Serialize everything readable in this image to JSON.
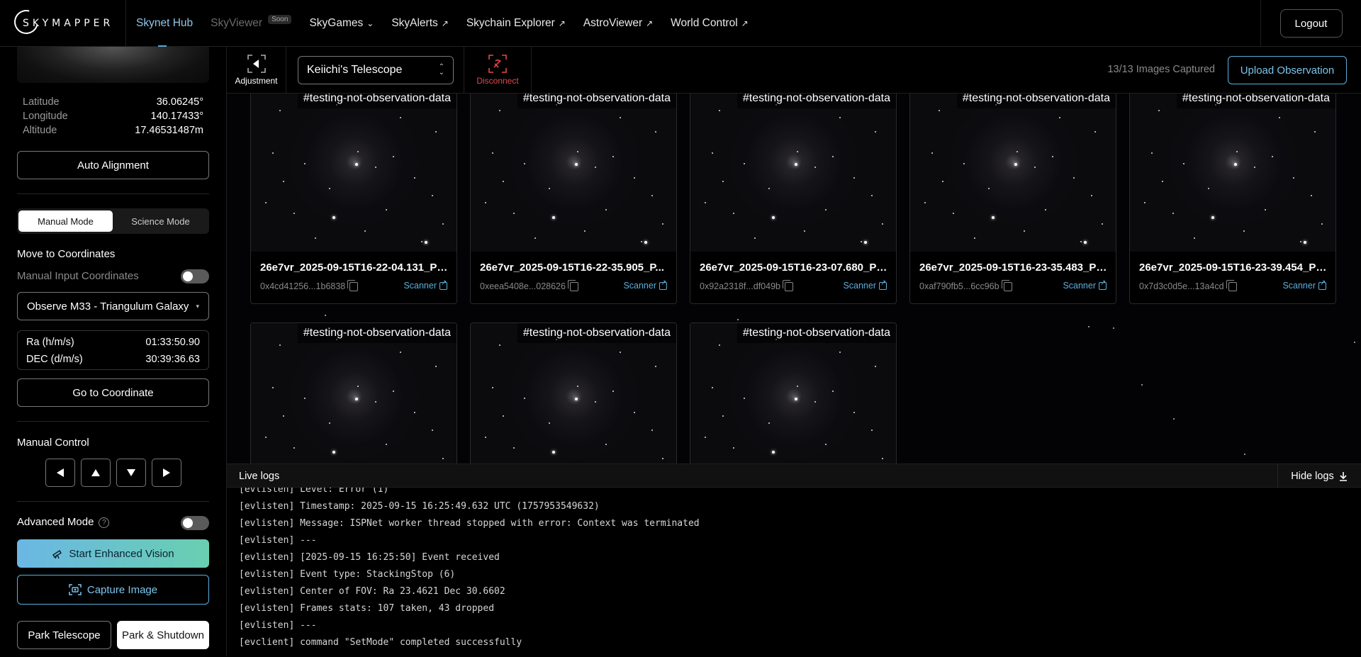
{
  "nav": {
    "brand": "SKYMAPPER",
    "items": [
      {
        "label": "Skynet Hub",
        "state": "active"
      },
      {
        "label": "SkyViewer",
        "badge": "Soon",
        "state": "muted"
      },
      {
        "label": "SkyGames",
        "icon": "chevron-down-icon"
      },
      {
        "label": "SkyAlerts",
        "icon": "external-arrow-icon"
      },
      {
        "label": "Skychain Explorer",
        "icon": "external-arrow-icon"
      },
      {
        "label": "AstroViewer",
        "icon": "external-arrow-icon"
      },
      {
        "label": "World Control",
        "icon": "external-arrow-icon"
      }
    ],
    "logout": "Logout"
  },
  "sidebar": {
    "location": [
      {
        "label": "Latitude",
        "value": "36.06245°"
      },
      {
        "label": "Longitude",
        "value": "140.17433°"
      },
      {
        "label": "Altitude",
        "value": "17.46531487m"
      }
    ],
    "auto_alignment": "Auto Alignment",
    "modes": [
      "Manual Mode",
      "Science Mode"
    ],
    "selected_mode": "Manual Mode",
    "move_heading": "Move to Coordinates",
    "manual_input_label": "Manual Input Coordinates",
    "target_select": "Observe M33 - Triangulum Galaxy",
    "ra_label": "Ra (h/m/s)",
    "ra_value": "01:33:50.90",
    "dec_label": "DEC (d/m/s)",
    "dec_value": "30:39:36.63",
    "goto": "Go to Coordinate",
    "manual_control": "Manual Control",
    "advanced_mode": "Advanced Mode",
    "enhanced_vision": "Start Enhanced Vision",
    "capture": "Capture Image",
    "park": "Park Telescope",
    "park_shutdown": "Park & Shutdown"
  },
  "toolbar": {
    "adjustment": "Adjustment",
    "telescope": "Keiichi's Telescope",
    "disconnect": "Disconnect",
    "image_count": "13/13 Images Captured",
    "upload": "Upload Observation"
  },
  "gallery": {
    "scanner_label": "Scanner",
    "cards": [
      {
        "tag": "#testing-not-observation-data",
        "title": "26e7vr_2025-09-15T16-22-04.131_PR...",
        "hash": "0x4cd41256...1b6838"
      },
      {
        "tag": "#testing-not-observation-data",
        "title": "26e7vr_2025-09-15T16-22-35.905_P...",
        "hash": "0xeea5408e...028626"
      },
      {
        "tag": "#testing-not-observation-data",
        "title": "26e7vr_2025-09-15T16-23-07.680_PR...",
        "hash": "0x92a2318f...df049b"
      },
      {
        "tag": "#testing-not-observation-data",
        "title": "26e7vr_2025-09-15T16-23-35.483_PR...",
        "hash": "0xaf790fb5...6cc96b"
      },
      {
        "tag": "#testing-not-observation-data",
        "title": "26e7vr_2025-09-15T16-23-39.454_PR...",
        "hash": "0x7d3c0d5e...13a4cd"
      },
      {
        "tag": "#testing-not-observation-data"
      },
      {
        "tag": "#testing-not-observation-data"
      },
      {
        "tag": "#testing-not-observation-data"
      }
    ]
  },
  "logs": {
    "title": "Live logs",
    "hide": "Hide logs",
    "lines": [
      "[evlisten] Level: Error (1)",
      "[evlisten] Timestamp: 2025-09-15 16:25:49.632 UTC (1757953549632)",
      "[evlisten] Message: ISPNet worker thread stopped with error: Context was terminated",
      "[evlisten] ---",
      "[evlisten] [2025-09-15 16:25:50] Event received",
      "[evlisten] Event type: StackingStop (6)",
      "[evlisten] Center of FOV: Ra 23.4621 Dec 30.6602",
      "[evlisten] Frames stats: 107 taken, 43 dropped",
      "[evlisten] ---",
      "[evclient] command \"SetMode\" completed successfully"
    ]
  }
}
